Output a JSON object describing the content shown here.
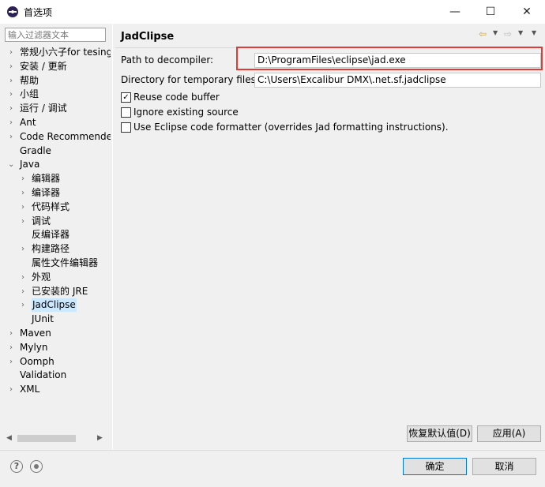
{
  "window": {
    "title": "首选项",
    "minimize_glyph": "—",
    "maximize_glyph": "☐",
    "close_glyph": "✕"
  },
  "sidebar": {
    "filter_placeholder": "输入过滤器文本",
    "items": [
      {
        "label": "常规小六子for tesing",
        "expandable": true,
        "level": 0
      },
      {
        "label": "安装 / 更新",
        "expandable": true,
        "level": 0
      },
      {
        "label": "帮助",
        "expandable": true,
        "level": 0
      },
      {
        "label": "小组",
        "expandable": true,
        "level": 0
      },
      {
        "label": "运行 / 调试",
        "expandable": true,
        "level": 0
      },
      {
        "label": "Ant",
        "expandable": true,
        "level": 0
      },
      {
        "label": "Code Recommenders",
        "expandable": true,
        "level": 0
      },
      {
        "label": "Gradle",
        "expandable": false,
        "level": 0
      },
      {
        "label": "Java",
        "expandable": true,
        "expanded": true,
        "level": 0
      },
      {
        "label": "编辑器",
        "expandable": true,
        "level": 1
      },
      {
        "label": "编译器",
        "expandable": true,
        "level": 1
      },
      {
        "label": "代码样式",
        "expandable": true,
        "level": 1
      },
      {
        "label": "调试",
        "expandable": true,
        "level": 1
      },
      {
        "label": "反编译器",
        "expandable": false,
        "level": 1
      },
      {
        "label": "构建路径",
        "expandable": true,
        "level": 1
      },
      {
        "label": "属性文件编辑器",
        "expandable": false,
        "level": 1
      },
      {
        "label": "外观",
        "expandable": true,
        "level": 1
      },
      {
        "label": "已安装的 JRE",
        "expandable": true,
        "level": 1
      },
      {
        "label": "JadClipse",
        "expandable": true,
        "level": 1,
        "selected": true
      },
      {
        "label": "JUnit",
        "expandable": false,
        "level": 1
      },
      {
        "label": "Maven",
        "expandable": true,
        "level": 0
      },
      {
        "label": "Mylyn",
        "expandable": true,
        "level": 0
      },
      {
        "label": "Oomph",
        "expandable": true,
        "level": 0
      },
      {
        "label": "Validation",
        "expandable": false,
        "level": 0
      },
      {
        "label": "XML",
        "expandable": true,
        "level": 0
      }
    ]
  },
  "content": {
    "title": "JadClipse",
    "decompiler_label": "Path to decompiler:",
    "decompiler_value": "D:\\ProgramFiles\\eclipse\\jad.exe",
    "tempdir_label": "Directory for temporary files:",
    "tempdir_value": "C:\\Users\\Excalibur DMX\\.net.sf.jadclipse",
    "options": [
      {
        "label": "Reuse code buffer",
        "checked": true
      },
      {
        "label": "Ignore existing source",
        "checked": false
      },
      {
        "label": "Use Eclipse code formatter (overrides Jad formatting instructions).",
        "checked": false
      }
    ],
    "restore_defaults_label": "恢复默认值(D)",
    "apply_label": "应用(A)"
  },
  "footer": {
    "help_glyph": "?",
    "ok_label": "确定",
    "cancel_label": "取消"
  },
  "colors": {
    "highlight": "#e53935",
    "selection": "#cce8ff",
    "primary_border": "#0078d7"
  }
}
